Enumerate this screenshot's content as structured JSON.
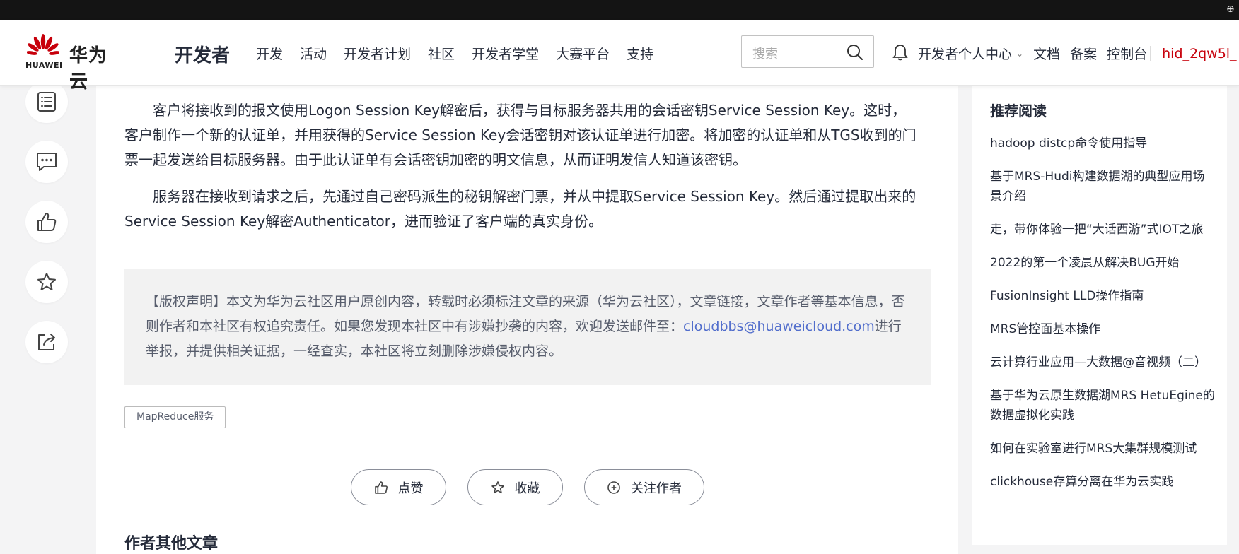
{
  "header": {
    "brand": "华为云",
    "brand_word": "HUAWEI",
    "dev_title": "开发者",
    "nav": [
      "开发",
      "活动",
      "开发者计划",
      "社区",
      "开发者学堂",
      "大赛平台",
      "支持"
    ],
    "search_placeholder": "搜索",
    "dev_center": "开发者个人中心",
    "docs": "文档",
    "filing": "备案",
    "console": "控制台",
    "user": "hid_2qw5l_"
  },
  "article": {
    "p1": "客户将接收到的报文使用Logon Session Key解密后，获得与目标服务器共用的会话密钥Service Session Key。这时，客户制作一个新的认证单，并用获得的Service Session Key会话密钥对该认证单进行加密。将加密的认证单和从TGS收到的门票一起发送给目标服务器。由于此认证单有会话密钥加密的明文信息，从而证明发信人知道该密钥。",
    "p2": "服务器在接收到请求之后，先通过自己密码派生的秘钥解密门票，并从中提取Service Session Key。然后通过提取出来的Service Session Key解密Authenticator，进而验证了客户端的真实身份。",
    "copyright_before": "【版权声明】本文为华为云社区用户原创内容，转载时必须标注文章的来源（华为云社区），文章链接，文章作者等基本信息，否则作者和本社区有权追究责任。如果您发现本社区中有涉嫌抄袭的内容，欢迎发送邮件至：",
    "copyright_email": "cloudbbs@huaweicloud.com",
    "copyright_after": "进行举报，并提供相关证据，一经查实，本社区将立刻删除涉嫌侵权内容。",
    "tag": "MapReduce服务",
    "like": "点赞",
    "collect": "收藏",
    "follow": "关注作者",
    "other_title": "作者其他文章"
  },
  "recommend": {
    "title": "推荐阅读",
    "items": [
      "hadoop distcp命令使用指导",
      "基于MRS-Hudi构建数据湖的典型应用场景介绍",
      "走，带你体验一把“大话西游”式IOT之旅",
      "2022的第一个凌晨从解决BUG开始",
      "FusionInsight LLD操作指南",
      "MRS管控面基本操作",
      "云计算行业应用—大数据@音视频（二）",
      "基于华为云原生数据湖MRS HetuEgine的数据虚拟化实践",
      "如何在实验室进行MRS大集群规模测试",
      "clickhouse存算分离在华为云实践"
    ]
  },
  "colors": {
    "brand_red": "#c7000b",
    "link_blue": "#526ecc"
  }
}
